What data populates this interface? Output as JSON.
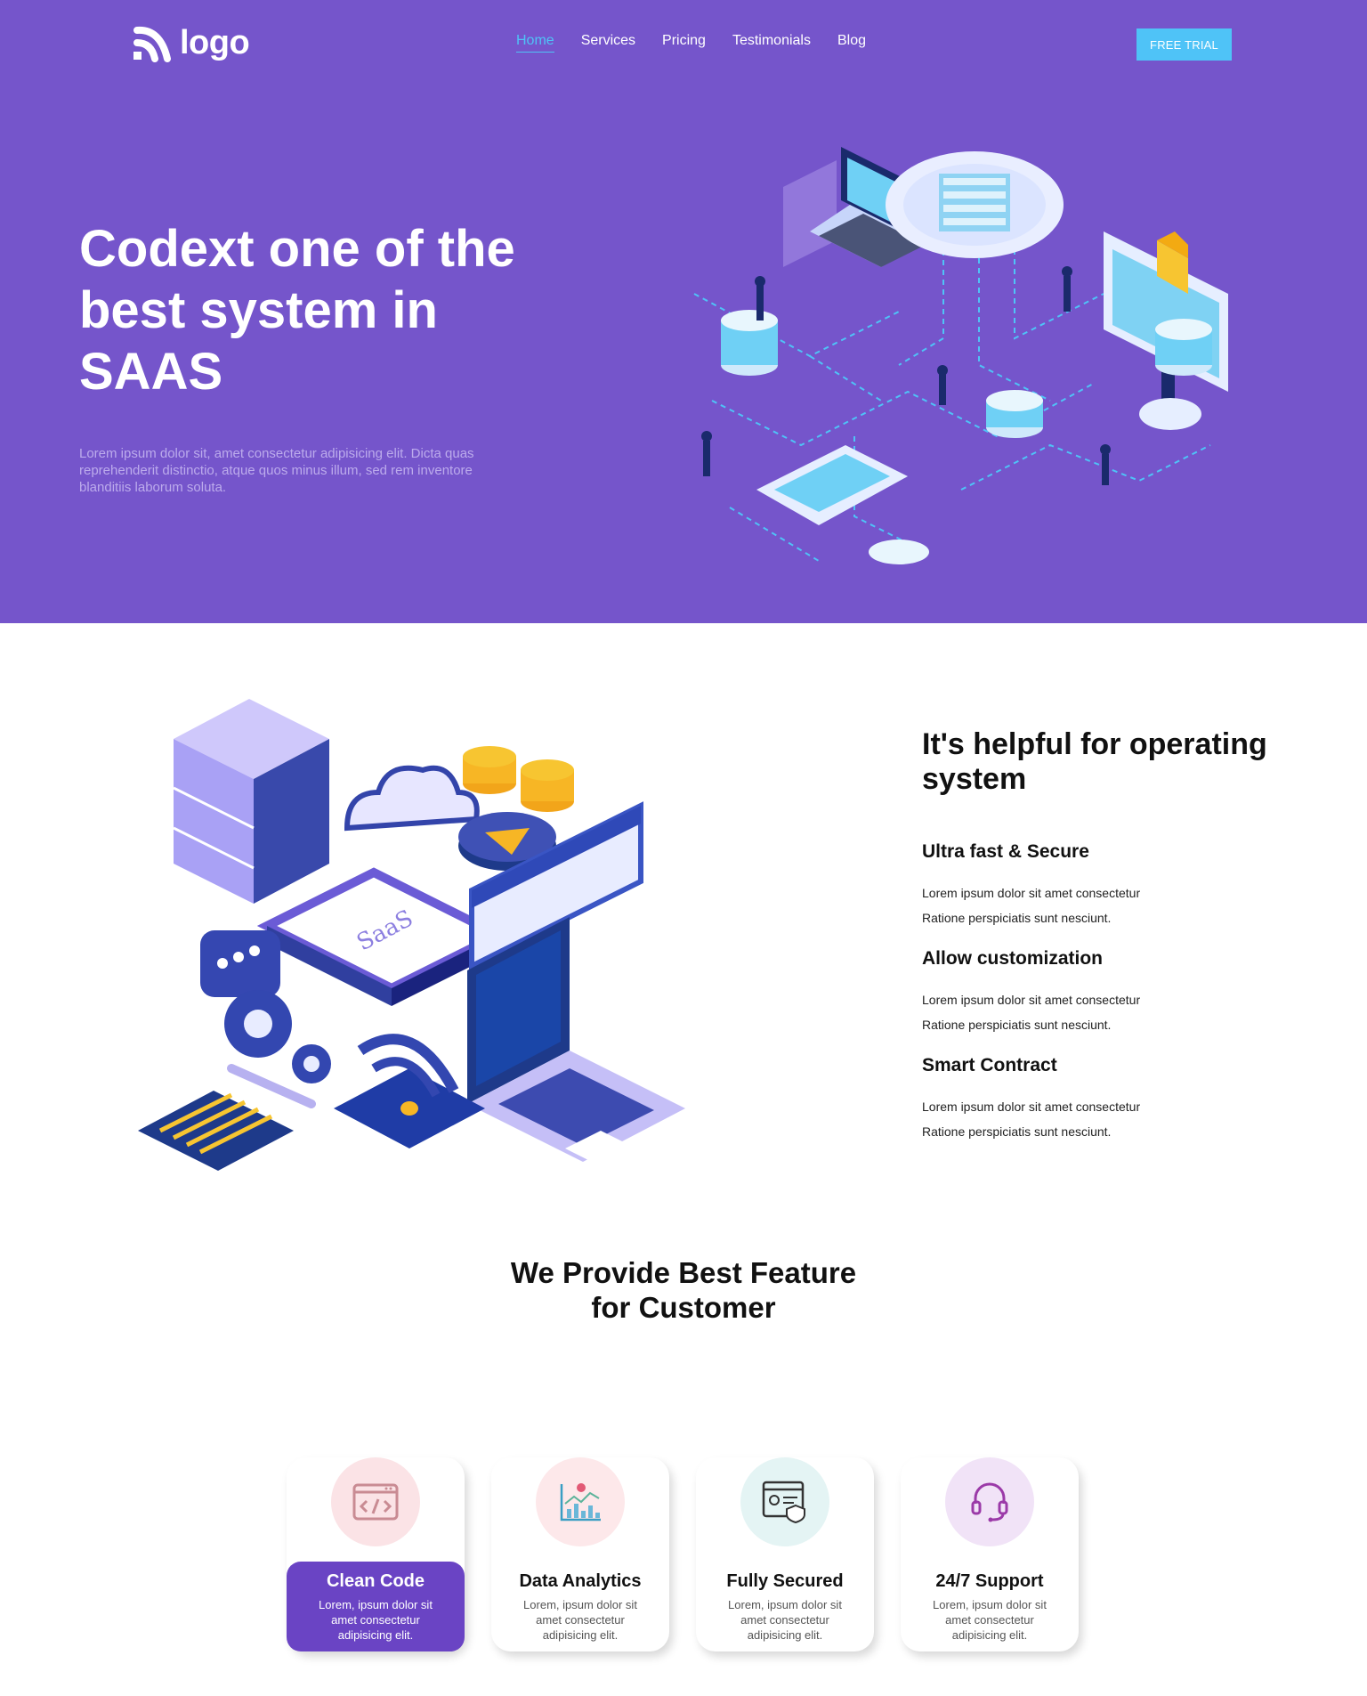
{
  "header": {
    "logo_text": "logo",
    "nav": [
      "Home",
      "Services",
      "Pricing",
      "Testimonials",
      "Blog"
    ],
    "active_nav": "Home",
    "cta": "FREE TRIAL"
  },
  "hero": {
    "title": "Codext one of the best system in SAAS",
    "description": "Lorem ipsum dolor sit, amet consectetur adipisicing elit. Dicta quas reprehenderit distinctio, atque quos minus illum, sed rem inventore blanditiis laborum soluta."
  },
  "about": {
    "title": "It's helpful for operating system",
    "illustration_text": "SaaS",
    "features": [
      {
        "title": "Ultra fast & Secure",
        "line1": "Lorem ipsum dolor sit amet consectetur",
        "line2": "Ratione perspiciatis sunt nesciunt."
      },
      {
        "title": "Allow customization",
        "line1": "Lorem ipsum dolor sit amet consectetur",
        "line2": "Ratione perspiciatis sunt nesciunt."
      },
      {
        "title": "Smart Contract",
        "line1": "Lorem ipsum dolor sit amet consectetur",
        "line2": "Ratione perspiciatis sunt nesciunt."
      }
    ]
  },
  "features_section": {
    "title_line1": "We Provide Best Feature",
    "title_line2": "for Customer",
    "cards": [
      {
        "title": "Clean Code",
        "text": "Lorem, ipsum dolor sit amet consectetur adipisicing elit.",
        "icon": "code-window-icon"
      },
      {
        "title": "Data Analytics",
        "text": "Lorem, ipsum dolor sit amet consectetur adipisicing elit.",
        "icon": "analytics-chart-icon"
      },
      {
        "title": "Fully Secured",
        "text": "Lorem, ipsum dolor sit amet consectetur adipisicing elit.",
        "icon": "secure-browser-icon"
      },
      {
        "title": "24/7 Support",
        "text": "Lorem, ipsum dolor sit amet consectetur adipisicing elit.",
        "icon": "headset-icon"
      }
    ]
  },
  "colors": {
    "hero_bg": "#7555cb",
    "accent": "#4fc3f7",
    "active_card": "#6a44c4"
  }
}
